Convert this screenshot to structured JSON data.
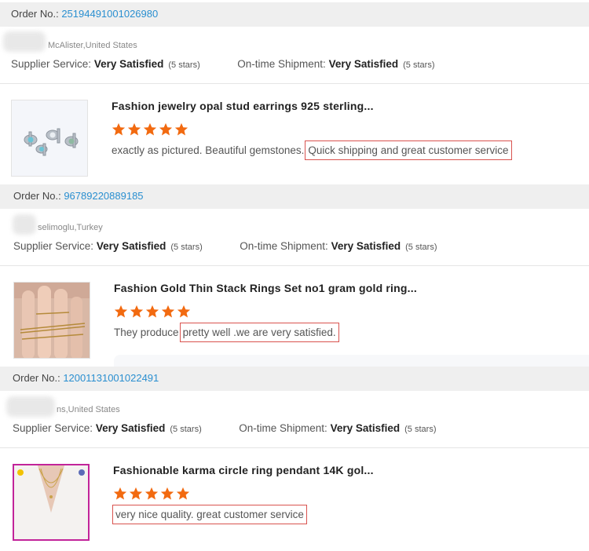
{
  "labels": {
    "order_no": "Order No.:",
    "supplier_service": "Supplier Service:",
    "on_time_shipment": "On-time Shipment:",
    "very_satisfied": "Very Satisfied",
    "five_stars": "(5 stars)"
  },
  "colors": {
    "star": "#f26a10",
    "link": "#2a8fd0",
    "highlight_border": "#d9534f",
    "order_bar_bg": "#efefef"
  },
  "reviews": [
    {
      "order_no": "25194491001026980",
      "buyer": "McAlister,United States",
      "product_title": "Fashion jewelry opal stud earrings 925 sterling...",
      "stars": 5,
      "review_text": "exactly as pictured. Beautiful gemstones.",
      "review_highlight": "Quick shipping and great customer service",
      "thumb": "earrings-image"
    },
    {
      "order_no": "96789220889185",
      "buyer": "selimoglu,Turkey",
      "product_title": "Fashion Gold Thin Stack Rings Set no1 gram gold ring...",
      "stars": 5,
      "review_text": "They produce",
      "review_highlight": "pretty well .we are very satisfied.",
      "thumb": "rings-image"
    },
    {
      "order_no": "12001131001022491",
      "buyer": "ns,United States",
      "product_title": "Fashionable karma circle ring pendant 14K gol...",
      "stars": 5,
      "review_text": "",
      "review_highlight": "very nice quality. great customer service",
      "thumb": "necklace-image"
    }
  ]
}
